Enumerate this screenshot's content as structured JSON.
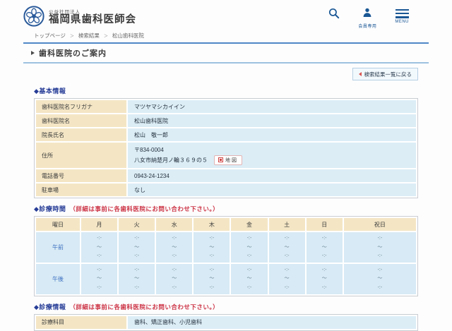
{
  "header": {
    "org_type": "公益社団法人",
    "org_name": "福岡県歯科医師会",
    "actions": {
      "member_label": "会員専用",
      "menu_label": "MENU"
    }
  },
  "breadcrumb": {
    "separator": "＞",
    "items": [
      "トップページ",
      "検索結果",
      "松山歯科医院"
    ]
  },
  "page_title": "歯科医院のご案内",
  "back_button_label": "検索結果一覧に戻る",
  "sections": {
    "basic": {
      "heading": "◆基本情報",
      "rows": [
        {
          "label": "歯科医院名フリガナ",
          "value": "マツヤマシカイイン"
        },
        {
          "label": "歯科医院名",
          "value": "松山歯科医院"
        },
        {
          "label": "院長氏名",
          "value": "松山　敬一郎"
        },
        {
          "label": "住所",
          "postal_code": "〒834-0004",
          "street": "八女市納楚月ノ輪３６９の５",
          "map_button_label": "地図"
        },
        {
          "label": "電話番号",
          "value": "0943-24-1234"
        },
        {
          "label": "駐車場",
          "value": "なし"
        }
      ]
    },
    "hours": {
      "heading": "◆診療時間",
      "note": "（詳細は事前に各歯科医院にお問い合わせ下さい。）",
      "columns": [
        "曜日",
        "月",
        "火",
        "水",
        "木",
        "金",
        "土",
        "日",
        "祝日"
      ],
      "rows": [
        {
          "label": "午前",
          "cells": [
            [
              "-:-",
              "～",
              "-:-"
            ],
            [
              "-:-",
              "～",
              "-:-"
            ],
            [
              "-:-",
              "～",
              "-:-"
            ],
            [
              "-:-",
              "～",
              "-:-"
            ],
            [
              "-:-",
              "～",
              "-:-"
            ],
            [
              "-:-",
              "～",
              "-:-"
            ],
            [
              "-:-",
              "～",
              "-:-"
            ],
            [
              "-:-",
              "～",
              "-:-"
            ]
          ]
        },
        {
          "label": "午後",
          "cells": [
            [
              "-:-",
              "～",
              "-:-"
            ],
            [
              "-:-",
              "～",
              "-:-"
            ],
            [
              "-:-",
              "～",
              "-:-"
            ],
            [
              "-:-",
              "～",
              "-:-"
            ],
            [
              "-:-",
              "～",
              "-:-"
            ],
            [
              "-:-",
              "～",
              "-:-"
            ],
            [
              "-:-",
              "～",
              "-:-"
            ],
            [
              "-:-",
              "～",
              "-:-"
            ]
          ]
        }
      ]
    },
    "info": {
      "heading": "◆診療情報",
      "note": "（詳細は事前に各歯科医院にお問い合わせ下さい。）",
      "rows": [
        {
          "label": "診療科目",
          "value": "歯科、矯正歯科、小児歯科"
        }
      ]
    }
  },
  "icons": {
    "search": "search-icon",
    "member": "person-icon",
    "menu": "hamburger-icon",
    "map": "map-marker-icon",
    "back": "left-arrow-icon"
  },
  "colors": {
    "accent_navy": "#1a5794",
    "heading_blue": "#263c96",
    "note_red": "#cc3344",
    "label_cell_bg": "#f4e6c5",
    "value_cell_bg": "#dcedf6",
    "schedule_cell_bg": "#d7eaf5",
    "back_arrow_red": "#d9534f",
    "title_border_blue": "#4f88c7"
  }
}
